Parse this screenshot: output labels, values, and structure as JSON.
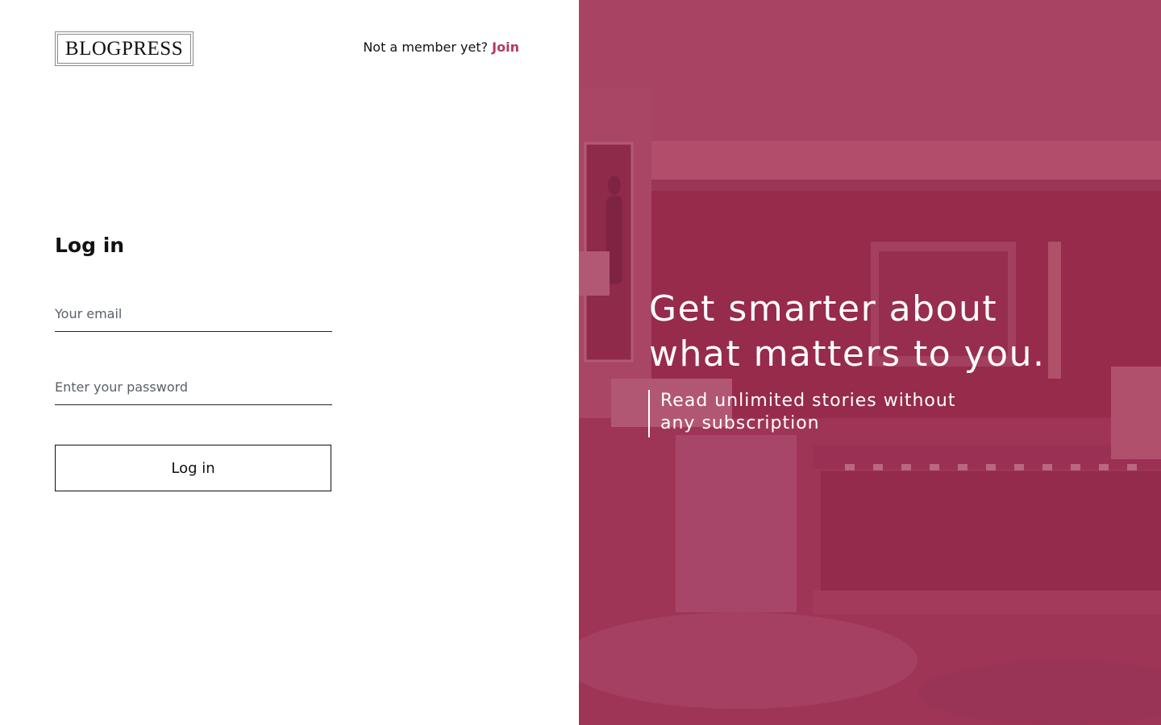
{
  "header": {
    "logo_text": "BLOGPRESS",
    "join_prompt": "Not a member yet?",
    "join_label": "Join"
  },
  "login_form": {
    "title": "Log in",
    "email_placeholder": "Your email",
    "password_placeholder": "Enter your password",
    "submit_label": "Log in"
  },
  "hero": {
    "headline_line1": "Get smarter about",
    "headline_line2": "what matters to you.",
    "subtext_line1": "Read unlimited stories without",
    "subtext_line2": "any subscription",
    "background_image": "living-room-photo",
    "overlay_color": "#a23a5a"
  },
  "colors": {
    "accent": "#b33a5d",
    "text": "#111111",
    "muted_text": "#5a5f6b"
  }
}
